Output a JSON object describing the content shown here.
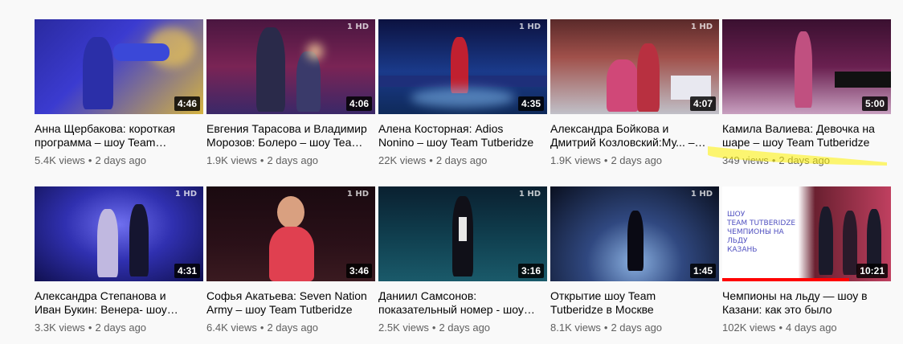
{
  "videos": [
    {
      "title": "Анна Щербакова: короткая программа – шоу Team Tutberidze",
      "duration": "4:46",
      "views": "5.4K views",
      "age": "2 days ago"
    },
    {
      "title": "Евгения Тарасова и Владимир Морозов: Болеро – шоу Team Tutberidze",
      "duration": "4:06",
      "views": "1.9K views",
      "age": "2 days ago"
    },
    {
      "title": "Алена Косторная: Adios Nonino – шоу Team Tutberidze",
      "duration": "4:35",
      "views": "22K views",
      "age": "2 days ago"
    },
    {
      "title": "Александра Бойкова и Дмитрий Козловский:Му... – шоу Team Tutberidze",
      "duration": "4:07",
      "views": "1.9K views",
      "age": "2 days ago"
    },
    {
      "title": "Камила Валиева: Девочка на шаре – шоу Team Tutberidze",
      "duration": "5:00",
      "views": "349 views",
      "age": "2 days ago"
    },
    {
      "title": "Александра Степанова и Иван Букин: Венера- шоу Team Tutberidze",
      "duration": "4:31",
      "views": "3.3K views",
      "age": "2 days ago"
    },
    {
      "title": "Софья Акатьева: Seven Nation Army – шоу Team Tutberidze",
      "duration": "3:46",
      "views": "6.4K views",
      "age": "2 days ago"
    },
    {
      "title": "Даниил Самсонов: показательный номер - шоу Team Tutberidze",
      "duration": "3:16",
      "views": "2.5K views",
      "age": "2 days ago"
    },
    {
      "title": "Открытие шоу Team Tutberidze в Москве",
      "duration": "1:45",
      "views": "8.1K views",
      "age": "2 days ago"
    },
    {
      "title": "Чемпионы на льду — шоу в Казани: как это было",
      "duration": "10:21",
      "views": "102K views",
      "age": "4 days ago"
    }
  ],
  "watched_progress": 0.75,
  "highlight_color": "#fff200"
}
